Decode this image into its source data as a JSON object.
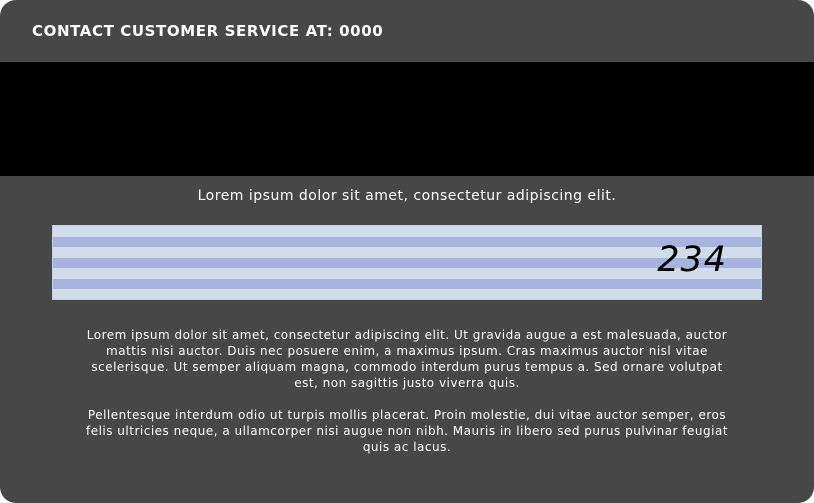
{
  "header": {
    "contact": "CONTACT CUSTOMER SERVICE AT: 0000"
  },
  "tagline": "Lorem ipsum dolor sit amet, consectetur adipiscing elit.",
  "signature_strip": {
    "cvv": "234"
  },
  "paragraphs": [
    "Lorem ipsum dolor sit amet, consectetur adipiscing elit. Ut gravida augue a est malesuada, auctor mattis nisi auctor. Duis nec posuere enim, a maximus ipsum. Cras maximus auctor nisl vitae scelerisque. Ut semper aliquam magna, commodo interdum purus tempus a. Sed ornare volutpat est, non sagittis justo viverra quis.",
    "Pellentesque interdum odio ut turpis mollis placerat. Proin molestie, dui vitae auctor semper, eros felis ultricies neque, a ullamcorper nisi augue non nibh. Mauris in libero sed purus pulvinar feugiat quis ac lacus."
  ],
  "colors": {
    "card_background": "#474747",
    "magnetic_stripe": "#000000",
    "strip_light": "#d0dcea",
    "strip_dark": "#a9b3df",
    "text": "#ffffff"
  }
}
